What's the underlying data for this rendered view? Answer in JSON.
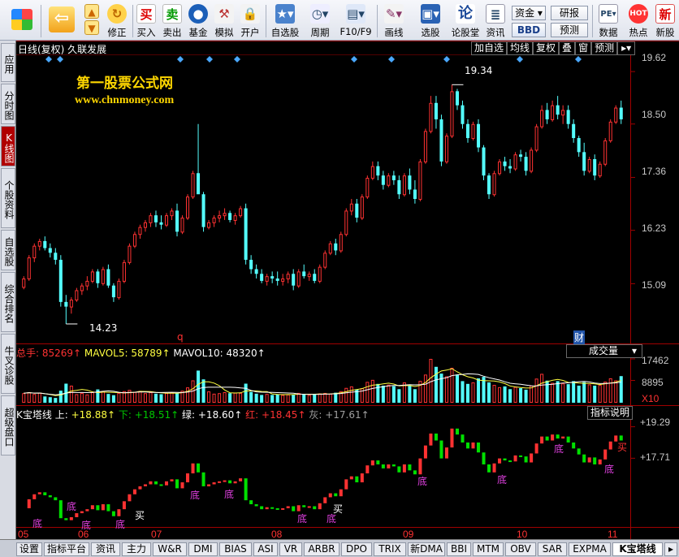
{
  "toolbar": {
    "buy": "买入",
    "sell": "卖出",
    "fund": "基金",
    "simulate": "模拟",
    "open_account": "开户",
    "fix": "修正",
    "watchlist": "自选股",
    "period": "周期",
    "f10": "F10/F9",
    "draw": "画线",
    "pick": "选股",
    "forum": "论股堂",
    "news": "资讯",
    "capital": "资金",
    "bbd": "BBD",
    "research": "研报",
    "forecast": "预测",
    "data": "数据",
    "hot": "热点",
    "new_stock": "新股"
  },
  "stock": {
    "title": "日线(复权)  久联发展"
  },
  "chart_buttons": {
    "add_watch": "加自选",
    "ma": "均线",
    "restore": "复权",
    "overlay": "叠",
    "window": "窗",
    "forecast": "预测"
  },
  "price_axis": [
    "19.62",
    "18.50",
    "17.36",
    "16.23",
    "15.09"
  ],
  "annotations": {
    "high_label": "19.34",
    "low_label": "14.23",
    "event_q": "q",
    "event_cai": "财"
  },
  "watermark": {
    "line1": "第一股票公式网",
    "line2": "www.chnmoney.com"
  },
  "volume_panel": {
    "selector": "成交量",
    "total_label": "总手: ",
    "total_value": "85269↑",
    "ma5_label": "MAVOL5: ",
    "ma5_value": "58789↑",
    "ma10_label": "MAVOL10: ",
    "ma10_value": "48320↑",
    "axis": [
      "17462",
      "8895"
    ],
    "multiplier": "X10"
  },
  "indicator_panel": {
    "name": "K宝塔线",
    "up_label": "上: ",
    "up_value": "+18.88↑",
    "down_label": "下: ",
    "down_value": "+18.51↑",
    "green_label": "绿: ",
    "green_value": "+18.60↑",
    "red_label": "红: ",
    "red_value": "+18.45↑",
    "gray_label": "灰: ",
    "gray_value": "+17.61↑",
    "explain_button": "指标说明",
    "axis": [
      "+19.29",
      "+17.71"
    ],
    "marks": {
      "bottom": "底",
      "buy": "买"
    }
  },
  "months": [
    "05",
    "06",
    "07",
    "08",
    "09",
    "10",
    "11"
  ],
  "bottom_tabs": [
    "设置",
    "指标平台",
    "资讯",
    "主力",
    "W&R",
    "DMI",
    "BIAS",
    "ASI",
    "VR",
    "ARBR",
    "DPO",
    "TRIX",
    "新DMA",
    "BBI",
    "MTM",
    "OBV",
    "SAR",
    "EXPMA",
    "K宝塔线"
  ],
  "left_tabs": [
    "应用",
    "分时图",
    "K线图",
    "个股资料",
    "自选股",
    "综合排名",
    "牛叉诊股",
    "超级盘口"
  ],
  "colors": {
    "up": "#ff3232",
    "down": "#54ffff",
    "panel_border": "#a00000",
    "watermark": "#ffd700",
    "indicator_green": "#00e000",
    "indicator_yellow": "#ffff00"
  },
  "chart_data": {
    "type": "candlestick",
    "price_range": [
      13.9,
      19.9
    ],
    "candles": [
      [
        15.02,
        15.25,
        14.97,
        15.2
      ],
      [
        15.2,
        15.7,
        15.15,
        15.65
      ],
      [
        15.65,
        15.95,
        15.55,
        15.9
      ],
      [
        15.9,
        16.05,
        15.8,
        16.0
      ],
      [
        16.0,
        16.1,
        15.8,
        15.85
      ],
      [
        15.85,
        15.95,
        15.65,
        15.75
      ],
      [
        15.75,
        15.85,
        15.5,
        15.6
      ],
      [
        15.6,
        15.7,
        14.6,
        14.7
      ],
      [
        14.7,
        14.85,
        14.23,
        14.6
      ],
      [
        14.6,
        14.8,
        14.45,
        14.75
      ],
      [
        14.75,
        15.0,
        14.7,
        14.95
      ],
      [
        14.95,
        15.1,
        14.85,
        15.05
      ],
      [
        15.05,
        15.25,
        14.95,
        15.15
      ],
      [
        15.15,
        15.4,
        15.1,
        15.35
      ],
      [
        15.35,
        15.4,
        15.0,
        15.1
      ],
      [
        15.1,
        15.45,
        15.05,
        15.4
      ],
      [
        15.4,
        15.5,
        15.0,
        15.05
      ],
      [
        15.05,
        15.1,
        14.7,
        14.8
      ],
      [
        14.8,
        15.2,
        14.75,
        15.15
      ],
      [
        15.15,
        15.6,
        15.1,
        15.55
      ],
      [
        15.55,
        15.95,
        15.5,
        15.9
      ],
      [
        15.9,
        16.2,
        15.85,
        16.15
      ],
      [
        16.15,
        16.35,
        16.05,
        16.3
      ],
      [
        16.3,
        16.45,
        16.2,
        16.4
      ],
      [
        16.4,
        16.6,
        16.3,
        16.55
      ],
      [
        16.55,
        16.65,
        16.3,
        16.4
      ],
      [
        16.4,
        16.55,
        16.25,
        16.35
      ],
      [
        16.35,
        16.6,
        16.3,
        16.55
      ],
      [
        16.55,
        16.7,
        16.45,
        16.65
      ],
      [
        16.65,
        16.8,
        16.1,
        16.2
      ],
      [
        16.2,
        16.55,
        16.15,
        16.5
      ],
      [
        16.5,
        17.0,
        16.45,
        16.95
      ],
      [
        16.95,
        17.5,
        16.9,
        17.45
      ],
      [
        17.45,
        18.5,
        17.4,
        17.0
      ],
      [
        17.0,
        17.05,
        16.2,
        16.3
      ],
      [
        16.3,
        16.45,
        16.25,
        16.4
      ],
      [
        16.4,
        16.55,
        16.3,
        16.5
      ],
      [
        16.5,
        16.65,
        16.4,
        16.55
      ],
      [
        16.55,
        16.7,
        16.45,
        16.6
      ],
      [
        16.6,
        16.65,
        16.4,
        16.45
      ],
      [
        16.45,
        16.6,
        16.35,
        16.55
      ],
      [
        16.55,
        16.75,
        16.5,
        16.7
      ],
      [
        16.7,
        16.8,
        15.5,
        15.6
      ],
      [
        15.6,
        15.7,
        15.3,
        15.4
      ],
      [
        15.4,
        15.5,
        15.2,
        15.3
      ],
      [
        15.3,
        15.4,
        15.1,
        15.15
      ],
      [
        15.15,
        15.3,
        15.05,
        15.25
      ],
      [
        15.25,
        15.35,
        15.1,
        15.2
      ],
      [
        15.2,
        15.35,
        15.05,
        15.15
      ],
      [
        15.15,
        15.3,
        15.05,
        15.2
      ],
      [
        15.2,
        15.35,
        15.1,
        15.3
      ],
      [
        15.3,
        15.4,
        14.95,
        15.05
      ],
      [
        15.05,
        15.4,
        15.0,
        15.35
      ],
      [
        15.35,
        15.5,
        15.2,
        15.25
      ],
      [
        15.25,
        15.35,
        15.15,
        15.3
      ],
      [
        15.3,
        15.4,
        15.1,
        15.15
      ],
      [
        15.15,
        15.5,
        15.1,
        15.45
      ],
      [
        15.45,
        15.8,
        15.4,
        15.75
      ],
      [
        15.75,
        16.0,
        15.7,
        15.95
      ],
      [
        15.95,
        16.05,
        15.7,
        15.8
      ],
      [
        15.8,
        16.2,
        15.75,
        16.15
      ],
      [
        16.15,
        16.7,
        16.1,
        16.65
      ],
      [
        16.65,
        16.9,
        16.55,
        16.8
      ],
      [
        16.8,
        16.9,
        16.4,
        16.5
      ],
      [
        16.5,
        17.0,
        16.45,
        16.95
      ],
      [
        16.95,
        17.4,
        16.9,
        17.35
      ],
      [
        17.35,
        17.7,
        17.3,
        17.6
      ],
      [
        17.6,
        17.7,
        17.3,
        17.4
      ],
      [
        17.4,
        17.5,
        17.1,
        17.2
      ],
      [
        17.2,
        17.45,
        17.15,
        17.4
      ],
      [
        17.4,
        17.5,
        17.2,
        17.3
      ],
      [
        17.3,
        17.4,
        16.9,
        17.0
      ],
      [
        17.0,
        17.45,
        16.95,
        17.4
      ],
      [
        17.4,
        17.55,
        17.0,
        17.1
      ],
      [
        17.1,
        17.3,
        16.8,
        16.9
      ],
      [
        16.9,
        17.75,
        16.85,
        17.7
      ],
      [
        17.7,
        18.4,
        17.65,
        18.35
      ],
      [
        18.35,
        19.1,
        18.3,
        18.95
      ],
      [
        18.95,
        19.1,
        18.4,
        18.6
      ],
      [
        18.6,
        18.7,
        17.6,
        17.7
      ],
      [
        17.7,
        18.3,
        17.65,
        18.25
      ],
      [
        18.25,
        19.34,
        18.2,
        19.2
      ],
      [
        19.2,
        19.25,
        18.8,
        18.9
      ],
      [
        18.9,
        19.0,
        18.4,
        18.5
      ],
      [
        18.5,
        18.6,
        18.1,
        18.2
      ],
      [
        18.2,
        18.55,
        18.15,
        18.5
      ],
      [
        18.5,
        18.6,
        17.9,
        18.0
      ],
      [
        18.0,
        18.05,
        17.3,
        17.4
      ],
      [
        17.4,
        17.45,
        16.9,
        17.0
      ],
      [
        17.0,
        17.5,
        16.95,
        17.45
      ],
      [
        17.45,
        17.75,
        17.4,
        17.7
      ],
      [
        17.7,
        17.8,
        17.5,
        17.6
      ],
      [
        17.6,
        17.75,
        17.45,
        17.55
      ],
      [
        17.55,
        17.9,
        17.5,
        17.85
      ],
      [
        17.85,
        17.95,
        17.7,
        17.8
      ],
      [
        17.8,
        17.9,
        17.4,
        17.5
      ],
      [
        17.5,
        18.0,
        17.45,
        17.95
      ],
      [
        17.95,
        18.5,
        17.9,
        18.45
      ],
      [
        18.45,
        18.9,
        18.4,
        18.8
      ],
      [
        18.8,
        18.95,
        18.5,
        18.6
      ],
      [
        18.6,
        19.0,
        18.55,
        18.9
      ],
      [
        18.9,
        19.1,
        18.6,
        18.7
      ],
      [
        18.7,
        18.9,
        18.5,
        18.8
      ],
      [
        18.8,
        18.9,
        18.4,
        18.5
      ],
      [
        18.5,
        18.6,
        18.1,
        18.2
      ],
      [
        18.2,
        18.25,
        17.8,
        17.9
      ],
      [
        17.9,
        18.1,
        17.4,
        17.5
      ],
      [
        17.5,
        17.8,
        17.45,
        17.75
      ],
      [
        17.75,
        17.85,
        17.3,
        17.4
      ],
      [
        17.4,
        17.7,
        17.35,
        17.65
      ],
      [
        17.65,
        18.2,
        17.6,
        18.15
      ],
      [
        18.15,
        18.6,
        18.1,
        18.55
      ],
      [
        18.55,
        18.9,
        18.5,
        18.85
      ],
      [
        18.85,
        19.0,
        18.5,
        18.6
      ]
    ],
    "volume": [
      3800,
      4200,
      3500,
      4000,
      2500,
      2200,
      1900,
      4800,
      7600,
      6800,
      3400,
      3900,
      3300,
      4200,
      5300,
      4500,
      3500,
      3000,
      3900,
      4600,
      5100,
      4300,
      4700,
      3800,
      4200,
      3600,
      3400,
      3900,
      4100,
      3900,
      4800,
      6100,
      8900,
      12800,
      9300,
      4500,
      3600,
      3800,
      4200,
      3800,
      4000,
      3900,
      7600,
      4300,
      3600,
      3100,
      3500,
      3100,
      3400,
      3100,
      3300,
      3300,
      3900,
      3400,
      3100,
      3300,
      3700,
      3900,
      3600,
      4000,
      4600,
      5900,
      6500,
      5300,
      5800,
      8300,
      9100,
      7500,
      6800,
      7200,
      6600,
      5400,
      8100,
      6900,
      5400,
      8700,
      11200,
      17462,
      14300,
      11600,
      10500,
      13900,
      11200,
      8600,
      7500,
      8100,
      9700,
      10300,
      8100,
      7100,
      6200,
      6500,
      5400,
      6300,
      5800,
      5200,
      6800,
      9600,
      11500,
      8800,
      7900,
      8600,
      7700,
      7400,
      8600,
      6800,
      8200,
      7300,
      6800,
      7100,
      8400,
      9700,
      8900,
      10600
    ]
  }
}
